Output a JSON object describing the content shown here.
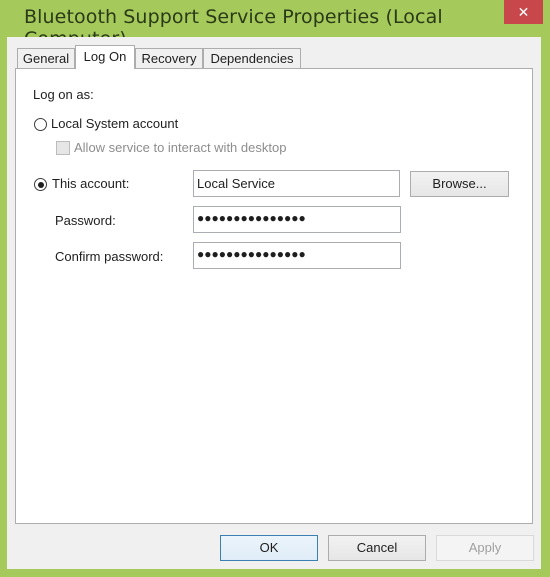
{
  "window": {
    "title": "Bluetooth Support Service Properties (Local Computer)",
    "close_glyph": "✕"
  },
  "tabs": [
    {
      "label": "General",
      "active": false
    },
    {
      "label": "Log On",
      "active": true
    },
    {
      "label": "Recovery",
      "active": false
    },
    {
      "label": "Dependencies",
      "active": false
    }
  ],
  "logon": {
    "heading": "Log on as:",
    "local_system_label": "Local System account",
    "local_system_selected": false,
    "interact_desktop_label": "Allow service to interact with desktop",
    "interact_desktop_checked": false,
    "interact_desktop_enabled": false,
    "this_account_label": "This account:",
    "this_account_selected": true,
    "account_value": "Local Service",
    "browse_label": "Browse...",
    "password_label": "Password:",
    "password_value": "●●●●●●●●●●●●●●●",
    "confirm_label": "Confirm password:",
    "confirm_value": "●●●●●●●●●●●●●●●"
  },
  "footer": {
    "ok_label": "OK",
    "cancel_label": "Cancel",
    "apply_label": "Apply",
    "apply_enabled": false
  }
}
